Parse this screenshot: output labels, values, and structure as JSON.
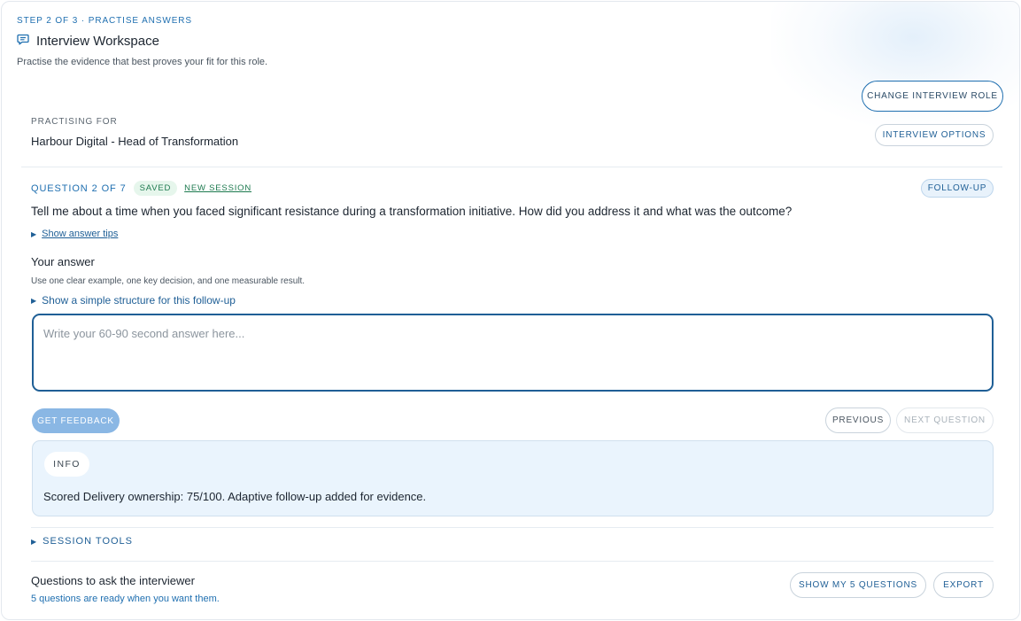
{
  "header": {
    "step": "STEP 2 OF 3 · PRACTISE ANSWERS",
    "title": "Interview Workspace",
    "title_icon": "chat-bubble-icon",
    "subtitle": "Practise the evidence that best proves your fit for this role."
  },
  "actions": {
    "change_role": "CHANGE INTERVIEW ROLE",
    "interview_options": "INTERVIEW OPTIONS"
  },
  "practising_for": {
    "label": "PRACTISING FOR",
    "value": "Harbour Digital - Head of Transformation"
  },
  "question": {
    "counter": "QUESTION 2 OF 7",
    "saved_badge": "SAVED",
    "new_session": "NEW SESSION",
    "follow_up": "FOLLOW-UP",
    "text": "Tell me about a time when you faced significant resistance during a transformation initiative. How did you address it and what was the outcome?",
    "tips_toggle": "Show answer tips"
  },
  "answer": {
    "label": "Your answer",
    "hint": "Use one clear example, one key decision, and one measurable result.",
    "structure_toggle": "Show a simple structure for this follow-up",
    "value": "",
    "placeholder": "Write your 60-90 second answer here..."
  },
  "controls": {
    "get_feedback": "GET FEEDBACK",
    "previous": "PREVIOUS",
    "next_question": "NEXT QUESTION"
  },
  "info": {
    "tag": "INFO",
    "message": "Scored Delivery ownership: 75/100. Adaptive follow-up added for evidence."
  },
  "session_tools": {
    "label": "SESSION TOOLS"
  },
  "interviewer_questions": {
    "title": "Questions to ask the interviewer",
    "subtitle": "5 questions are ready when you want them.",
    "show_button": "SHOW MY 5 QUESTIONS",
    "export_button": "EXPORT"
  },
  "colors": {
    "accent": "#1f6fb0",
    "accent_dark": "#1f5f96",
    "success": "#1d7a4f",
    "info_bg": "#eaf4fd",
    "feedback_disabled": "#8ab7e4"
  }
}
